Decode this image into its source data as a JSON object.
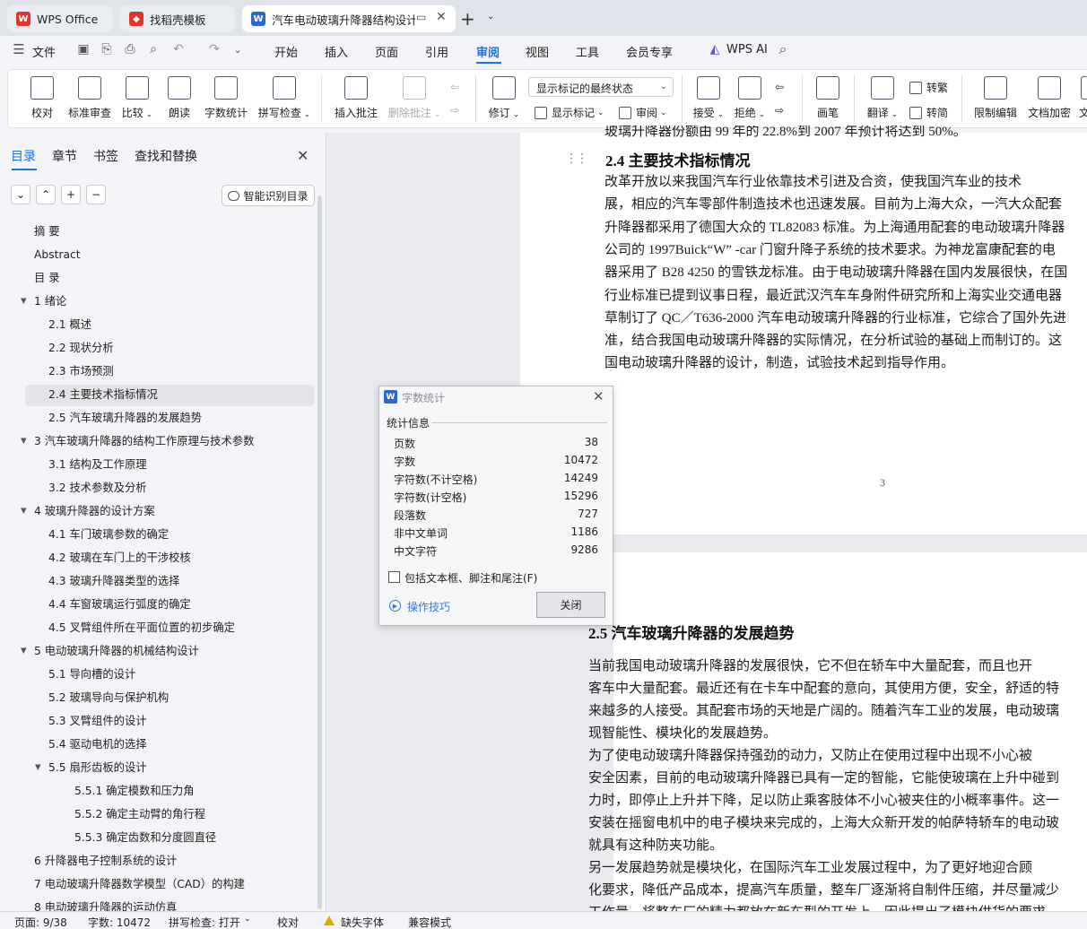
{
  "tabs": [
    {
      "label": "WPS Office",
      "icon": "wps-logo-icon",
      "color": "#e0352b"
    },
    {
      "label": "找稻壳模板",
      "icon": "docer-icon",
      "color": "#e0352b"
    },
    {
      "label": "汽车电动玻璃升降器结构设计",
      "icon": "writer-icon",
      "color": "#2f66d6"
    }
  ],
  "menu": {
    "file": "文件",
    "items": [
      "开始",
      "插入",
      "页面",
      "引用",
      "审阅",
      "视图",
      "工具",
      "会员专享"
    ],
    "active": "审阅",
    "ai": "WPS AI"
  },
  "ribbon": {
    "proofread": "校对",
    "standard_review": "标准审查",
    "compare": "比较",
    "read_aloud": "朗读",
    "word_count": "字数统计",
    "spell_check": "拼写检查",
    "insert_comment": "插入批注",
    "delete_comment": "删除批注",
    "revise": "修订",
    "markup_select": "显示标记的最终状态",
    "show_markup": "显示标记",
    "review_pane": "审阅",
    "accept": "接受",
    "reject": "拒绝",
    "pen": "画笔",
    "translate": "翻译",
    "to_traditional": "转繁",
    "to_simplified": "转简",
    "restrict_edit": "限制编辑",
    "doc_encrypt": "文档加密",
    "cut": "文"
  },
  "sidebar": {
    "tabs": [
      "目录",
      "章节",
      "书签",
      "查找和替换"
    ],
    "active_tab": "目录",
    "buttons": [
      "⌄",
      "⌃",
      "+",
      "−"
    ],
    "smart_button": "智能识别目录",
    "toc": [
      {
        "label": "摘  要",
        "level": 0,
        "caret": ""
      },
      {
        "label": "Abstract",
        "level": 0,
        "caret": ""
      },
      {
        "label": "目  录",
        "level": 0,
        "caret": ""
      },
      {
        "label": "1 绪论",
        "level": 0,
        "caret": "▼"
      },
      {
        "label": "2.1 概述",
        "level": 1,
        "caret": ""
      },
      {
        "label": "2.2 现状分析",
        "level": 1,
        "caret": ""
      },
      {
        "label": "2.3 市场预测",
        "level": 1,
        "caret": ""
      },
      {
        "label": "2.4 主要技术指标情况",
        "level": 1,
        "caret": "",
        "selected": true
      },
      {
        "label": "2.5   汽车玻璃升降器的发展趋势",
        "level": 1,
        "caret": ""
      },
      {
        "label": "3   汽车玻璃升降器的结构工作原理与技术参数",
        "level": 0,
        "caret": "▼"
      },
      {
        "label": "3.1   结构及工作原理",
        "level": 1,
        "caret": ""
      },
      {
        "label": "3.2  技术参数及分析",
        "level": 1,
        "caret": ""
      },
      {
        "label": "4  玻璃升降器的设计方案",
        "level": 0,
        "caret": "▼"
      },
      {
        "label": "4.1  车门玻璃参数的确定",
        "level": 1,
        "caret": ""
      },
      {
        "label": "4.2  玻璃在车门上的干涉校核",
        "level": 1,
        "caret": ""
      },
      {
        "label": "4.3  玻璃升降器类型的选择",
        "level": 1,
        "caret": ""
      },
      {
        "label": "4.4  车窗玻璃运行弧度的确定",
        "level": 1,
        "caret": ""
      },
      {
        "label": "4.5 叉臂组件所在平面位置的初步确定",
        "level": 1,
        "caret": ""
      },
      {
        "label": "5 电动玻璃升降器的机械结构设计",
        "level": 0,
        "caret": "▼"
      },
      {
        "label": "5.1 导向槽的设计",
        "level": 1,
        "caret": ""
      },
      {
        "label": "5.2  玻璃导向与保护机构",
        "level": 1,
        "caret": ""
      },
      {
        "label": "5.3  叉臂组件的设计",
        "level": 1,
        "caret": ""
      },
      {
        "label": "5.4    驱动电机的选择",
        "level": 1,
        "caret": ""
      },
      {
        "label": "5.5  扇形齿板的设计",
        "level": 1,
        "caret": "▼"
      },
      {
        "label": "5.5.1  确定模数和压力角",
        "level": 2,
        "caret": ""
      },
      {
        "label": "5.5.2  确定主动臂的角行程",
        "level": 2,
        "caret": ""
      },
      {
        "label": "5.5.3  确定齿数和分度圆直径",
        "level": 2,
        "caret": ""
      },
      {
        "label": "6  升降器电子控制系统的设计",
        "level": 0,
        "caret": ""
      },
      {
        "label": "7  电动玻璃升降器数学模型（CAD）的构建",
        "level": 0,
        "caret": ""
      },
      {
        "label": "8 电动玻璃升降器的运动仿真",
        "level": 0,
        "caret": ""
      }
    ]
  },
  "document": {
    "page1_top_partial": "玻璃升降器份额由 99 年的 22.8%到 2007 年预计将达到 50%。",
    "heading_24": "2.4 主要技术指标情况",
    "para_24": [
      "    改革开放以来我国汽车行业依靠技术引进及合资，使我国汽车业的技术",
      "展，相应的汽车零部件制造技术也迅速发展。目前为上海大众，一汽大众配套",
      "升降器都采用了德国大众的 TL82083 标准。为上海通用配套的电动玻璃升降器",
      "公司的 1997Buick“W” -car 门窗升降子系统的技术要求。为神龙富康配套的电",
      "器采用了 B28 4250 的雪铁龙标准。由于电动玻璃升降器在国内发展很快，在国",
      "行业标准已提到议事日程，最近武汉汽车车身附件研究所和上海实业交通电器",
      "草制订了 QC／T636-2000 汽车电动玻璃升降器的行业标准，它综合了国外先进",
      "准，结合我国电动玻璃升降器的实际情况，在分析试验的基础上而制订的。这",
      "国电动玻璃升降器的设计，制造，试验技术起到指导作用。"
    ],
    "page_number": "3",
    "heading_25": "2.5   汽车玻璃升降器的发展趋势",
    "para_25": [
      "        当前我国电动玻璃升降器的发展很快，它不但在轿车中大量配套，而且也开",
      "客车中大量配套。最近还有在卡车中配套的意向，其使用方便，安全，舒适的特",
      "来越多的人接受。其配套市场的天地是广阔的。随着汽车工业的发展，电动玻璃",
      "现智能性、模块化的发展趋势。",
      "        为了使电动玻璃升降器保持强劲的动力，又防止在使用过程中出现不小心被",
      "安全因素，目前的电动玻璃升降器已具有一定的智能，它能使玻璃在上升中碰到",
      "力时，即停止上升并下降，足以防止乘客肢体不小心被夹住的小概率事件。这一",
      "安装在摇窗电机中的电子模块来完成的，上海大众新开发的帕萨特轿车的电动玻",
      "就具有这种防夹功能。",
      "        另一发展趋势就是模块化，在国际汽车工业发展过程中，为了更好地迎合顾",
      "化要求，降低产品成本，提高汽车质量，整车厂逐渐将自制件压缩，并尽量减少",
      "工作量，将整车厂的精力都放在新车型的开发上，因此提出了模块供货的要求。"
    ]
  },
  "dialog": {
    "title": "字数统计",
    "section": "统计信息",
    "rows": [
      {
        "label": "页数",
        "value": "38"
      },
      {
        "label": "字数",
        "value": "10472"
      },
      {
        "label": "字符数(不计空格)",
        "value": "14249"
      },
      {
        "label": "字符数(计空格)",
        "value": "15296"
      },
      {
        "label": "段落数",
        "value": "727"
      },
      {
        "label": "非中文单词",
        "value": "1186"
      },
      {
        "label": "中文字符",
        "value": "9286"
      }
    ],
    "checkbox_label": "包括文本框、脚注和尾注(F)",
    "checkbox_checked": false,
    "tips": "操作技巧",
    "close": "关闭"
  },
  "status": {
    "page": "页面: 9/38",
    "words": "字数: 10472",
    "spell": "拼写检查: 打开",
    "proof": "校对",
    "missing_font": "缺失字体",
    "compat": "兼容模式"
  }
}
